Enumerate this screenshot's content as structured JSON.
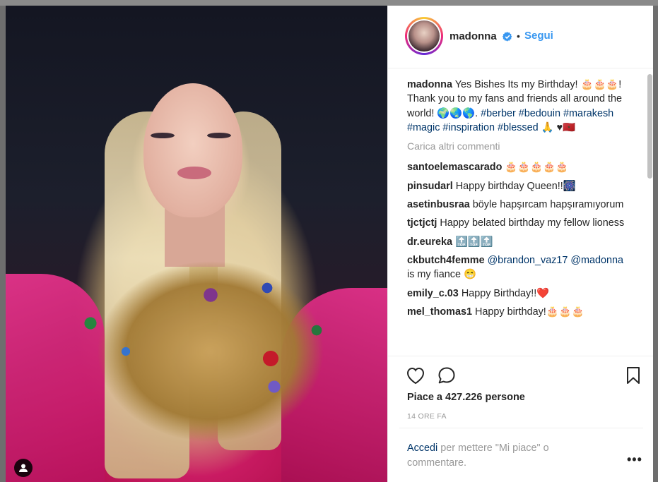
{
  "post": {
    "username": "madonna",
    "follow_label": "Segui",
    "separator": "•",
    "caption": {
      "user": "madonna",
      "text_1": "Yes Bishes Its my Birthday! 🎂🎂🎂! Thank you to my fans and friends all around the world! 🌍🌏🌎.",
      "tags": [
        "#berber",
        "#bedouin",
        "#marakesh",
        "#magic",
        "#inspiration",
        "#blessed"
      ],
      "trailing_emoji": "🙏 ♥🇲🇦"
    },
    "load_more": "Carica altri commenti",
    "comments": [
      {
        "user": "santoelemascarado",
        "text": "🎂🎂🎂🎂🎂"
      },
      {
        "user": "pinsudarl",
        "text": "Happy birthday Queen!!🎆"
      },
      {
        "user": "asetinbusraa",
        "text": "böyle hapşırcam hapşıramıyorum"
      },
      {
        "user": "tjctjctj",
        "text": "Happy belated birthday my fellow lioness"
      },
      {
        "user": "dr.eureka",
        "text": "🔝🔝🔝"
      },
      {
        "user": "ckbutch4femme",
        "mention_1": "@brandon_vaz17",
        "mention_2": "@madonna",
        "text": "is my fiance 😁"
      },
      {
        "user": "emily_c.03",
        "text": "Happy Birthday!!❤️"
      },
      {
        "user": "mel_thomas1",
        "text": "Happy birthday!🎂🎂🎂"
      }
    ],
    "likes_text": "Piace a 427.226 persone",
    "time_ago": "14 ORE FA",
    "login_link": "Accedi",
    "login_rest": "per mettere \"Mi piace\" o commentare.",
    "more_label": "•••"
  },
  "icons": {
    "like": "heart-icon",
    "comment": "comment-icon",
    "save": "bookmark-icon",
    "verified": "verified-badge-icon",
    "user_tag": "user-tag-icon"
  },
  "colors": {
    "link": "#3897f0",
    "hashtag": "#003569",
    "muted": "#999999",
    "text": "#262626"
  }
}
